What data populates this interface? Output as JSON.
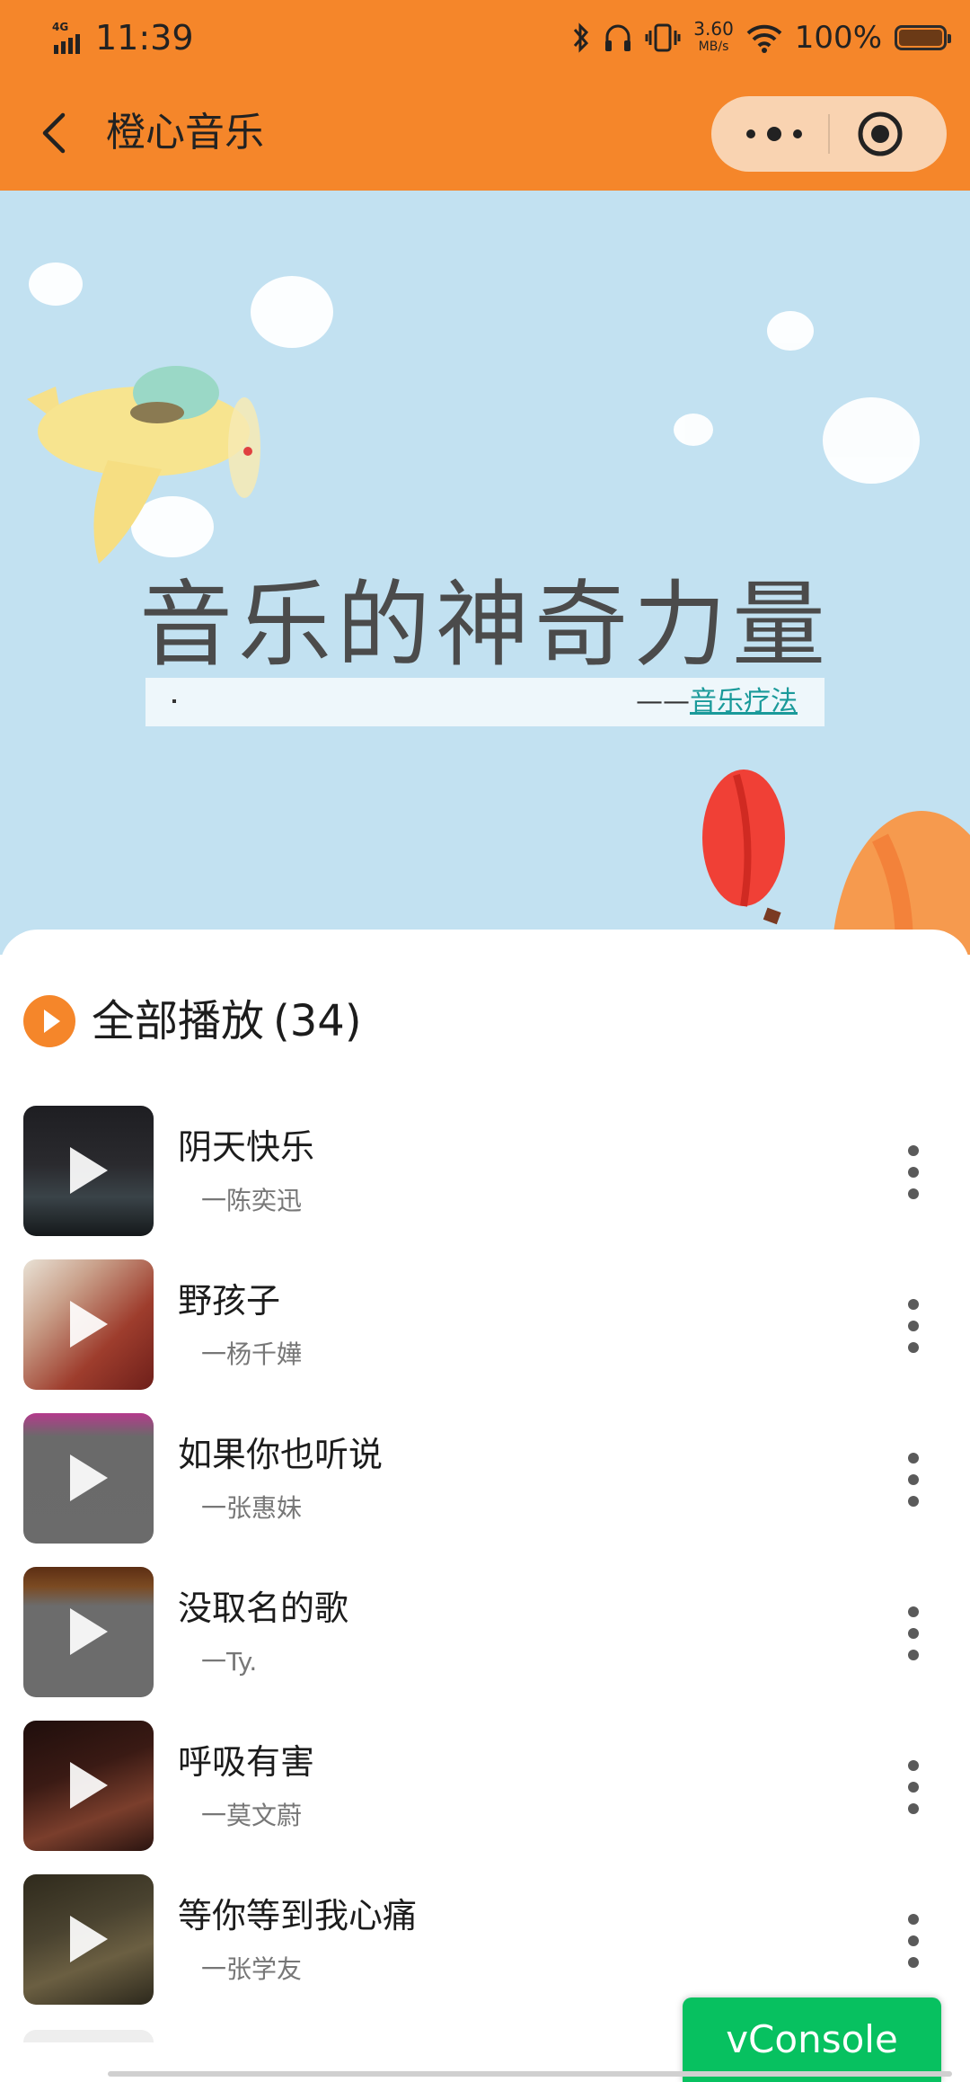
{
  "status_bar": {
    "network": "4G",
    "time": "11:39",
    "speed_value": "3.60",
    "speed_unit": "MB/s",
    "battery_text": "100%",
    "battery_level": 1.0
  },
  "navbar": {
    "title": "橙心音乐"
  },
  "banner": {
    "headline": "音乐的神奇力量",
    "source_dash": "——",
    "source_link": "音乐疗法"
  },
  "playlist": {
    "play_all_label": "全部播放",
    "count": "(34)",
    "songs": [
      {
        "title": "阴天快乐",
        "artist": "一陈奕迅"
      },
      {
        "title": "野孩子",
        "artist": "一杨千嬅"
      },
      {
        "title": "如果你也听说",
        "artist": "一张惠妹"
      },
      {
        "title": "没取名的歌",
        "artist": "一Ty."
      },
      {
        "title": "呼吸有害",
        "artist": "一莫文蔚"
      },
      {
        "title": "等你等到我心痛",
        "artist": "一张学友"
      }
    ]
  },
  "vconsole": {
    "label": "vConsole"
  },
  "colors": {
    "brand": "#f5862a",
    "banner_bg": "#c2e1f1",
    "vconsole": "#07c160"
  },
  "icons": {
    "back": "chevron-left-icon",
    "more": "more-dots-icon",
    "close": "target-close-icon",
    "play_all": "play-circle-icon",
    "song_more": "vertical-dots-icon"
  }
}
